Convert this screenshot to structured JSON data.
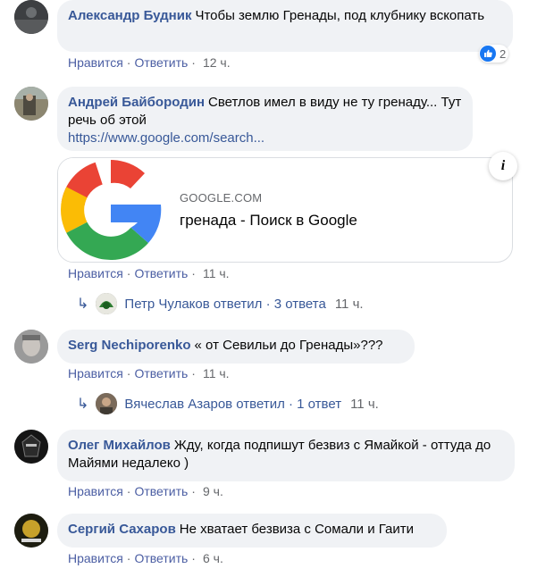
{
  "actions": {
    "like": "Нравится",
    "reply": "Ответить",
    "sep": "·"
  },
  "comments": [
    {
      "author": "Александр Будник",
      "text": "Чтобы землю Гренады, под клубнику вскопать",
      "time": "12 ч.",
      "reactions": {
        "icon": "like-icon",
        "count": "2"
      }
    },
    {
      "author": "Андрей Байбородин",
      "text": "Светлов имел в виду не ту гренаду... Тут речь об этой",
      "link": "https://www.google.com/search...",
      "preview": {
        "domain": "GOOGLE.COM",
        "title": "гренада - Поиск в Google",
        "info": "i"
      },
      "time": "11 ч.",
      "replies": {
        "text": "Петр Чулаков ответил · 3 ответа",
        "time": "11 ч."
      }
    },
    {
      "author": "Serg Nechiporenko",
      "text": "« от Севильи до Гренады»???",
      "time": "11 ч.",
      "replies": {
        "text": "Вячеслав Азаров ответил · 1 ответ",
        "time": "11 ч."
      }
    },
    {
      "author": "Олег Михайлов",
      "text": "Жду, когда подпишут безвиз с Ямайкой - оттуда до Майями недалеко )",
      "time": "9 ч."
    },
    {
      "author": "Сергий Сахаров",
      "text": "Не хватает безвиза с Сомали и Гаити",
      "time": "6 ч."
    }
  ],
  "colors": {
    "author": "#385898",
    "bubble": "#f0f2f5",
    "like_blue": "#1877f2",
    "muted": "#65676b"
  }
}
